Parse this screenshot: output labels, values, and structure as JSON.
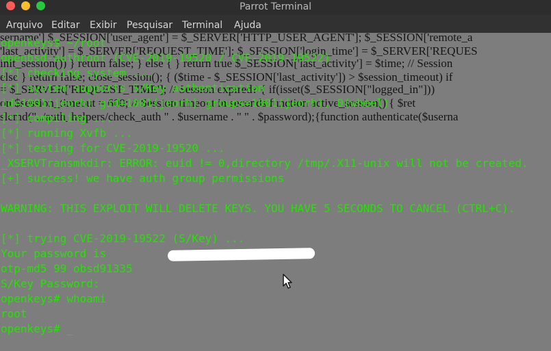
{
  "window": {
    "title": "Parrot Terminal"
  },
  "menu": [
    "Arquivo",
    "Editar",
    "Exibir",
    "Pesquisar",
    "Terminal",
    "Ajuda"
  ],
  "ghost_text": [
    "sername'] $_SESSION['user_agent'] = $_SERVER['HTTP_USER_AGENT']; $_SESSION['remote_a",
    "'last_activity'] = $_SERVER['REQUEST_TIME']; $_SESSION['login_time'] = $_SERVER['REQUES",
    "init_session()) } return false; } else { } return true $_SESSION['last_activity'] = $time; // Session",
    "else } return false; close_session(); { ($time - $_SESSION['last_activity']) > $session_timeout) if",
    "= $_SERVER['REQUEST_TIME']; // Session expired? { if(isset($_SESSION[\"logged_in\"]))",
    "on $session_timeout = 600; // Session timeout in seconds function active_session() { $ret",
    "slcmd(\"../auth_helpers/check_auth \" . $username . \" \" . $password);{function authenticate($userna"
  ],
  "terminal_lines": [
    "openkeys$ ~/root",
    "openbsd-authroot (CVE-2019-19520 / CVE-2019-19522)",
    "[*] checking system ...",
    "[*] system supports S/Key authentication",
    "id=1001(jeorh) gid=1001(jeorh) groups=1001(jeorh), 0(wheel)",
    "[*] compiling ...",
    "[*] running Xvfb ...",
    "[*] testing for CVE-2019-19520 ...",
    "_XSERVTransmkdir: ERROR: euid != 0,directory /tmp/.X11-unix will not be created.",
    "[+] success! we have auth group permissions",
    "",
    "WARNING: THIS EXPLOIT WILL DELETE KEYS. YOU HAVE 5 SECONDS TO CANCEL (CTRL+C).",
    "",
    "[*] trying CVE-2019-19522 (S/Key) ...",
    "Your password is",
    "otp-md5 99 obsd91335",
    "S/Key Password:",
    "openkeys# whoami",
    "root",
    "openkeys# _"
  ],
  "icons": {
    "close": "close-dot-icon",
    "minimize": "minimize-dot-icon",
    "maximize": "maximize-dot-icon",
    "pointer": "mouse-pointer-icon"
  },
  "colors": {
    "terminal_bg": "#7d7d7d",
    "terminal_text": "#22e400",
    "ghost_text": "#151515",
    "titlebar_bg": "#2d2d2d",
    "menubar_bg": "#313131"
  }
}
